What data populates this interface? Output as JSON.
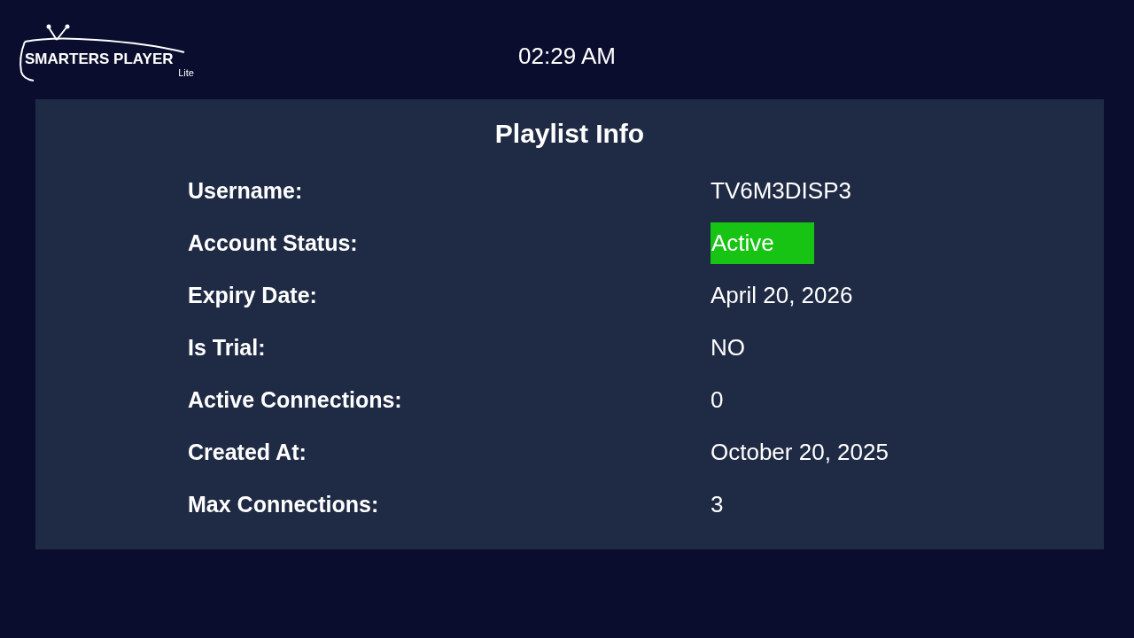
{
  "header": {
    "logo": {
      "name": "SMARTERS PLAYER",
      "edition": "Lite"
    },
    "time": "02:29 AM"
  },
  "panel": {
    "title": "Playlist Info",
    "rows": [
      {
        "label": "Username:",
        "value": "TV6M3DISP3",
        "kind": "text"
      },
      {
        "label": "Account Status:",
        "value": "Active",
        "kind": "badge",
        "color": "#17c414"
      },
      {
        "label": "Expiry Date:",
        "value": "April 20, 2026",
        "kind": "text"
      },
      {
        "label": "Is Trial:",
        "value": "NO",
        "kind": "text"
      },
      {
        "label": "Active Connections:",
        "value": "0",
        "kind": "text"
      },
      {
        "label": "Created At:",
        "value": "October 20, 2025",
        "kind": "text"
      },
      {
        "label": "Max Connections:",
        "value": "3",
        "kind": "text"
      }
    ]
  }
}
